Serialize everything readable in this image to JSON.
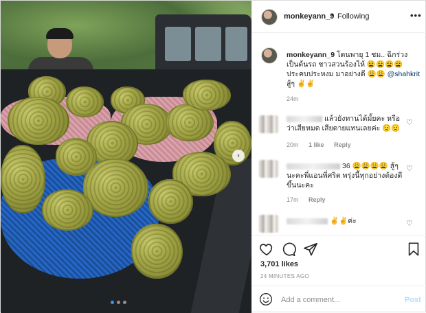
{
  "header": {
    "username": "monkeyann_9",
    "separator": "•",
    "follow_status": "Following",
    "more_label": "•••"
  },
  "caption": {
    "username": "monkeyann_9",
    "text_part1": "โดนพายุ 1 ชม.. ฉีกร่วงเป็นต้นรถ ชาวสวนร้องไห้ 😩😩😩😩 ประคบประหงม มาอย่างดี 😩😩",
    "mention": "@shahkrit",
    "text_part2": "สู้ๆ ✌️✌️",
    "time": "24m"
  },
  "comments": [
    {
      "text": "แล้วยังทานได้มั้ยคะ หรือว่าเสียหมด เสียดายแทนเลยค่ะ 😟😟",
      "time": "20m",
      "likes": "1 like",
      "reply": "Reply"
    },
    {
      "text": "36 😩😩😩😩 สู้ๆนะคะพี่แอนพี่ศริต พรุ่งนี้ทุกอย่างต้องดีขึ้นนะคะ",
      "time": "17m",
      "reply": "Reply"
    },
    {
      "text": "✌️✌️ค่ะ"
    }
  ],
  "actions": {
    "likes": "3,701 likes",
    "posted": "24 MINUTES AGO"
  },
  "add_comment": {
    "placeholder": "Add a comment...",
    "post_label": "Post"
  },
  "photo": {
    "next_label": "›",
    "carousel_total": 3,
    "carousel_active": 1
  },
  "colors": {
    "link": "#00376b",
    "muted": "#8e8e8e",
    "post_disabled": "#b2dffc",
    "dot_active": "#3897f0"
  }
}
